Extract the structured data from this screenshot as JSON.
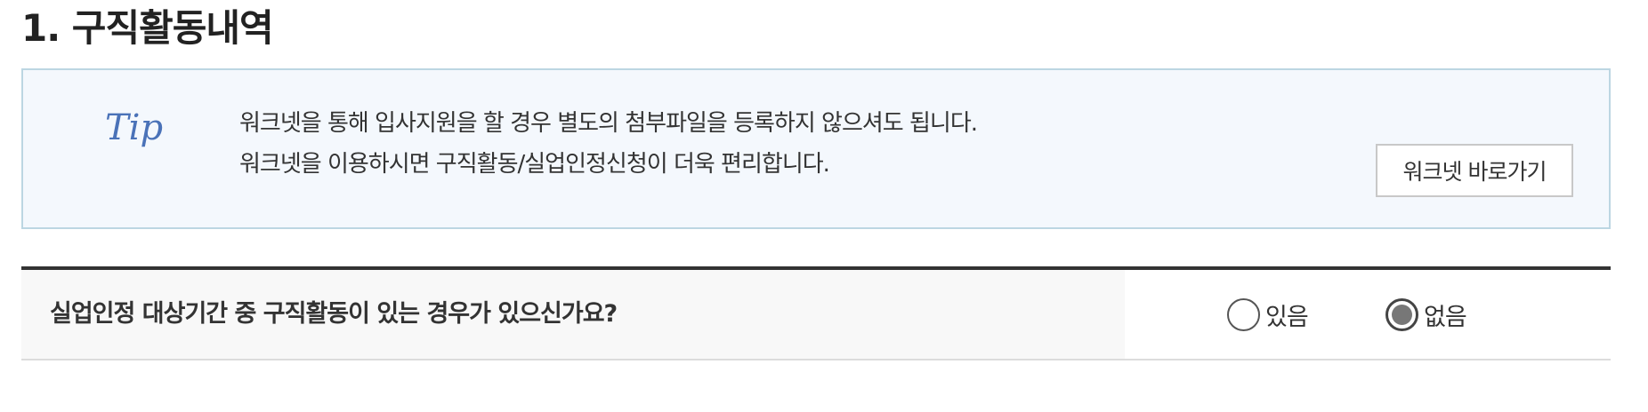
{
  "section": {
    "title": "1. 구직활동내역"
  },
  "tip": {
    "mark_text": "Tip",
    "line1": "워크넷을 통해 입사지원을 할 경우 별도의 첨부파일을 등록하지 않으셔도 됩니다.",
    "line2": "워크넷을 이용하시면 구직활동/실업인정신청이 더욱 편리합니다.",
    "button_label": "워크넷 바로가기"
  },
  "question": {
    "text": "실업인정 대상기간 중 구직활동이 있는 경우가 있으신가요?",
    "options": [
      {
        "label": "있음",
        "selected": false
      },
      {
        "label": "없음",
        "selected": true
      }
    ]
  },
  "colors": {
    "tip_border": "#bcd6e2",
    "tip_background": "#f4f8fd",
    "tip_mark": "#4a72b8",
    "row_top_border": "#333333",
    "question_background": "#f8f8f8"
  }
}
